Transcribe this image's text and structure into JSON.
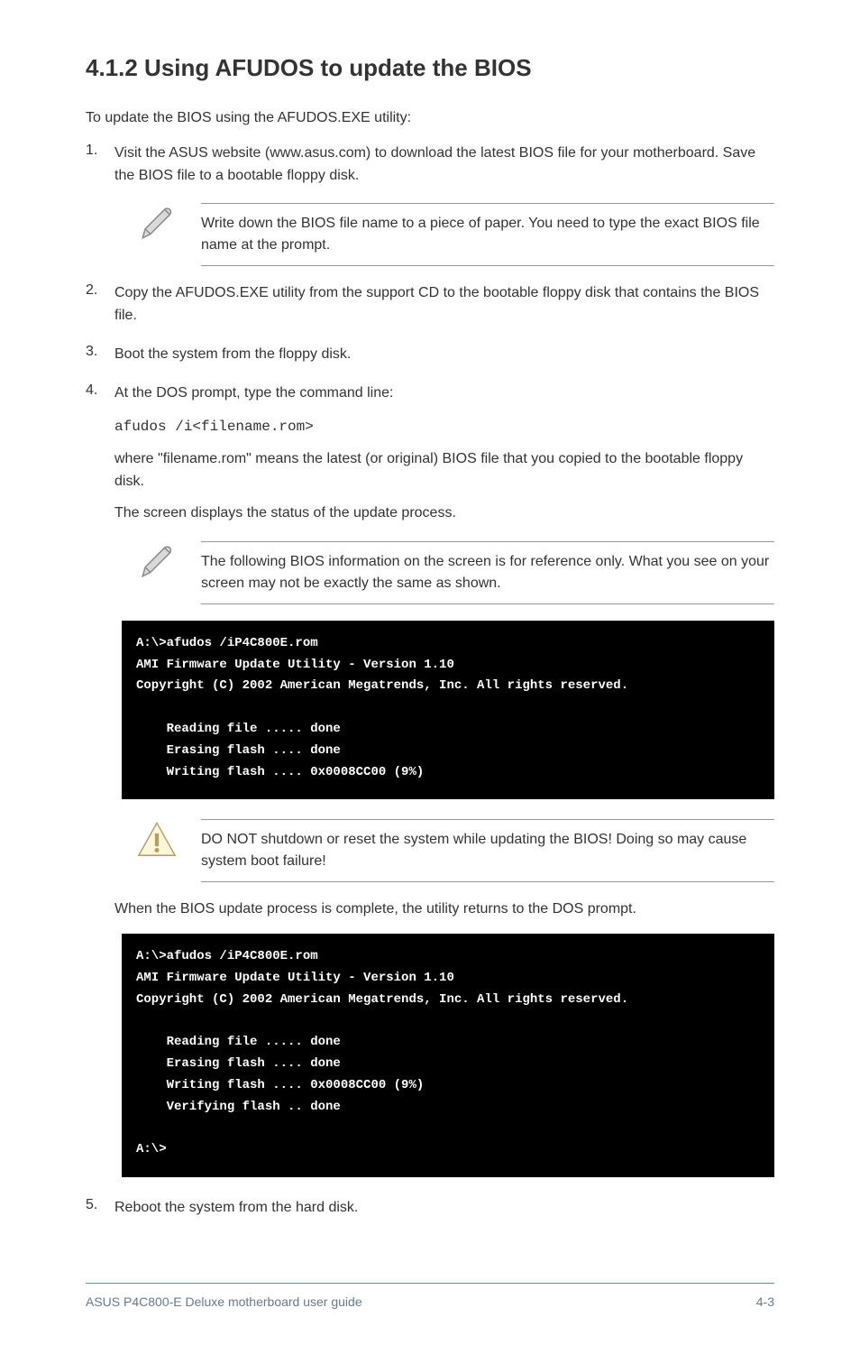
{
  "title": "4.1.2 Using AFUDOS to update the BIOS",
  "intro": "To update the BIOS using the AFUDOS.EXE utility:",
  "steps": [
    {
      "num": "1.",
      "text": "Visit the ASUS website (www.asus.com) to download the latest BIOS file for your motherboard. Save the BIOS file to a bootable floppy disk."
    }
  ],
  "note1": "Write down the BIOS file name to a piece of paper. You need to type the exact BIOS file name at the prompt.",
  "steps2": [
    {
      "num": "2.",
      "text": "Copy the AFUDOS.EXE utility from the support CD to the bootable floppy disk that contains the BIOS file."
    },
    {
      "num": "3.",
      "text": "Boot the system from the floppy disk."
    },
    {
      "num": "4.",
      "text": "At the DOS prompt, type the command line:"
    }
  ],
  "cmd_intro": "      afudos /i<filename.rom>",
  "cmd_expl": "where \"filename.rom\" means the latest (or original) BIOS file that you copied to the bootable floppy disk.",
  "cmd_note": "The screen displays the status of the update process.",
  "note2": "The following BIOS information on the screen is for reference only. What you see on your screen may not be exactly the same as shown.",
  "terminal1": "A:\\>afudos /iP4C800E.rom\nAMI Firmware Update Utility - Version 1.10\nCopyright (C) 2002 American Megatrends, Inc. All rights reserved.\n\n    Reading file ..... done\n    Erasing flash .... done\n    Writing flash .... 0x0008CC00 (9%)",
  "caution": "DO NOT shutdown or reset the system while updating the BIOS! Doing so may cause system boot failure!",
  "post_text": "When the BIOS update process is complete, the utility returns to the DOS prompt.",
  "terminal2": "A:\\>afudos /iP4C800E.rom\nAMI Firmware Update Utility - Version 1.10\nCopyright (C) 2002 American Megatrends, Inc. All rights reserved.\n\n    Reading file ..... done\n    Erasing flash .... done\n    Writing flash .... 0x0008CC00 (9%)\n    Verifying flash .. done\n\nA:\\>",
  "steps3": [
    {
      "num": "5.",
      "text": "Reboot the system from the hard disk."
    }
  ],
  "footer": {
    "left": "ASUS P4C800-E Deluxe motherboard user guide",
    "right": "4-3"
  }
}
